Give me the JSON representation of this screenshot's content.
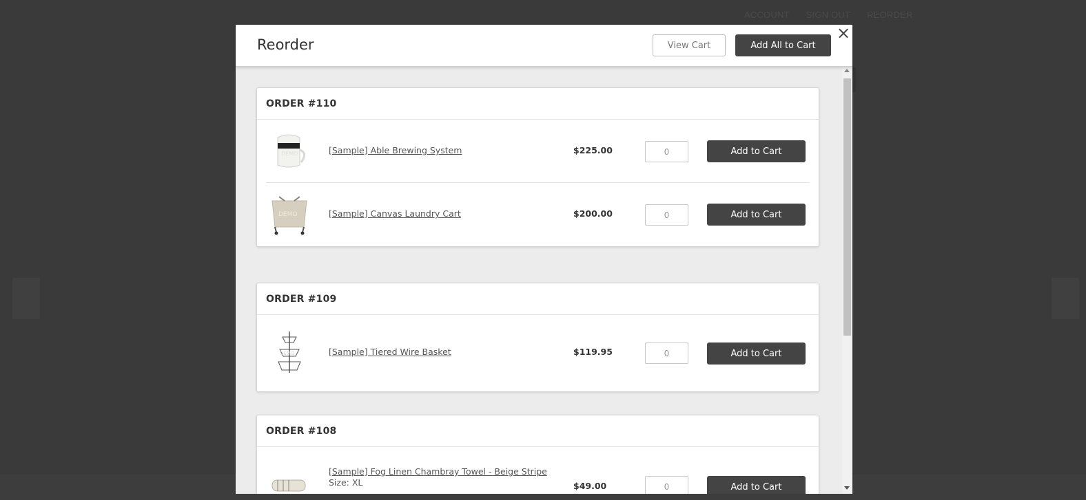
{
  "background_nav": [
    "ACCOUNT",
    "SIGN OUT",
    "REORDER"
  ],
  "modal": {
    "title": "Reorder",
    "view_cart_label": "View Cart",
    "add_all_label": "Add All to Cart",
    "close_symbol": "×"
  },
  "orders": [
    {
      "label": "ORDER #110",
      "items": [
        {
          "name": "[Sample] Able Brewing System",
          "price": "$225.00",
          "qty": "0",
          "button": "Add to Cart",
          "icon": "brewing-system-image"
        },
        {
          "name": "[Sample] Canvas Laundry Cart",
          "price": "$200.00",
          "qty": "0",
          "button": "Add to Cart",
          "icon": "laundry-cart-image"
        }
      ]
    },
    {
      "label": "ORDER #109",
      "items": [
        {
          "name": "[Sample] Tiered Wire Basket",
          "price": "$119.95",
          "qty": "0",
          "button": "Add to Cart",
          "icon": "wire-basket-image"
        }
      ]
    },
    {
      "label": "ORDER #108",
      "items": [
        {
          "name": "[Sample] Fog Linen Chambray Towel - Beige Stripe",
          "size_label": "Size:",
          "size_value": "XL",
          "price": "$49.00",
          "qty": "0",
          "button": "Add to Cart",
          "icon": "towel-image"
        }
      ]
    }
  ],
  "colors": {
    "overlay": "#3a3a3a",
    "button_dark": "#444444",
    "body_bg": "#ececec"
  }
}
